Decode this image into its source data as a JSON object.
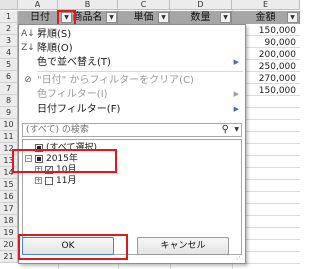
{
  "spreadsheet": {
    "columns": [
      "A",
      "B",
      "C",
      "D",
      "E"
    ],
    "rows": [
      "1",
      "2",
      "3",
      "4",
      "5",
      "6",
      "7",
      "8",
      "9",
      "10",
      "11",
      "12",
      "13",
      "14",
      "15",
      "16",
      "17",
      "18",
      "19",
      "20",
      "21"
    ],
    "header_cells": [
      "日付",
      "商品名",
      "単価",
      "数量",
      "金額"
    ],
    "amounts": [
      "150,000",
      "90,000",
      "200,000",
      "250,000",
      "270,000",
      "150,000"
    ],
    "colors": {
      "header_fill": "#a6a6a6",
      "highlight": "#e0191f"
    }
  },
  "filter_menu": {
    "items": [
      {
        "label": "昇順(S)",
        "icon": "sort-ascending-icon",
        "enabled": true
      },
      {
        "label": "降順(O)",
        "icon": "sort-descending-icon",
        "enabled": true
      },
      {
        "label": "色で並べ替え(T)",
        "enabled": true,
        "submenu": true
      },
      {
        "label": "\"日付\" からフィルターをクリア(C)",
        "icon": "clear-filter-icon",
        "enabled": false
      },
      {
        "label": "色フィルター(I)",
        "enabled": false,
        "submenu": true
      },
      {
        "label": "日付フィルター(F)",
        "enabled": true,
        "submenu": true
      }
    ],
    "search": {
      "placeholder": "(すべて) の検索",
      "value": ""
    },
    "tree": [
      {
        "label": "(すべて選択)",
        "state": "partial"
      },
      {
        "label": "2015年",
        "state": "partial",
        "expanded": true
      },
      {
        "label": "10月",
        "state": "checked",
        "expanded": false
      },
      {
        "label": "11月",
        "state": "unchecked",
        "expanded": false
      }
    ],
    "ok_label": "OK",
    "cancel_label": "キャンセル"
  }
}
